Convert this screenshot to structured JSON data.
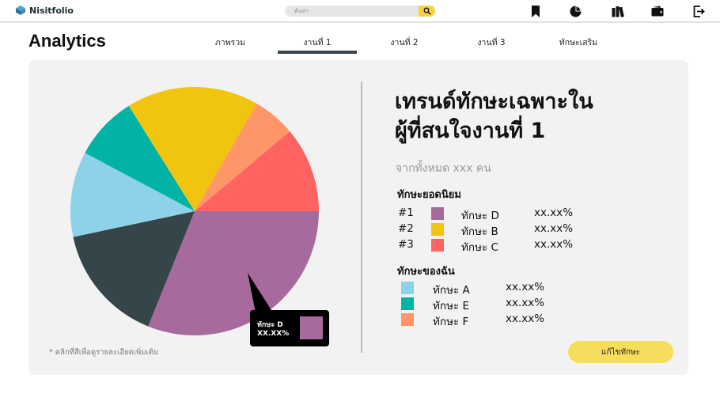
{
  "app": {
    "name": "Nisitfolio",
    "colors": {
      "accent": "#f4d33f",
      "dark": "#3a4448",
      "card": "#f2f2f2"
    }
  },
  "search": {
    "placeholder": "ค้นหา",
    "value": ""
  },
  "nav_icons": [
    "bookmark-icon",
    "pie-chart-icon",
    "books-icon",
    "wallet-icon",
    "logout-icon"
  ],
  "page": {
    "title": "Analytics",
    "tabs": [
      {
        "label": "ภาพรวม",
        "active": false
      },
      {
        "label": "งานที่ 1",
        "active": true
      },
      {
        "label": "งานที่ 2",
        "active": false
      },
      {
        "label": "งานที่ 3",
        "active": false
      },
      {
        "label": "ทักษะเสริม",
        "active": false
      }
    ]
  },
  "panel": {
    "headline_line1": "เทรนด์ทักษะเฉพาะใน",
    "headline_line2": "ผู้ที่สนใจงานที่ 1",
    "subtitle": "จากทั้งหมด xxx คน",
    "popular_title": "ทักษะยอดนิยม",
    "popular": [
      {
        "rank": "#1",
        "name": "ทักษะ D",
        "percent": "xx.xx%",
        "color": "#a66a9c"
      },
      {
        "rank": "#2",
        "name": "ทักษะ B",
        "percent": "xx.xx%",
        "color": "#f1c40f"
      },
      {
        "rank": "#3",
        "name": "ทักษะ C",
        "percent": "xx.xx%",
        "color": "#ff6361"
      }
    ],
    "mine_title": "ทักษะของฉัน",
    "mine": [
      {
        "name": "ทักษะ A",
        "percent": "xx.xx%",
        "color": "#8ed2ea"
      },
      {
        "name": "ทักษะ E",
        "percent": "xx.xx%",
        "color": "#00b3a4"
      },
      {
        "name": "ทักษะ F",
        "percent": "xx.xx%",
        "color": "#ff9668"
      }
    ],
    "edit_button": "แก้ไขทักษะ"
  },
  "tooltip": {
    "label": "ทักษะ D",
    "value": "XX.XX%",
    "color": "#a66a9c"
  },
  "hint": "* คลิกที่สีเพื่อดูรายละเอียดเพิ่มเติม",
  "chart_data": {
    "type": "pie",
    "slices": [
      {
        "name": "ทักษะ D",
        "color": "#a66a9c",
        "degrees": 112
      },
      {
        "color": "#36454a",
        "degrees": 56
      },
      {
        "name": "ทักษะ A",
        "color": "#8ed2ea",
        "degrees": 40
      },
      {
        "name": "ทักษะ E",
        "color": "#00b3a4",
        "degrees": 30
      },
      {
        "name": "ทักษะ B",
        "color": "#f1c40f",
        "degrees": 62
      },
      {
        "name": "ทักษะ F",
        "color": "#ff9668",
        "degrees": 20
      },
      {
        "name": "ทักษะ C",
        "color": "#ff6361",
        "degrees": 40
      }
    ]
  }
}
